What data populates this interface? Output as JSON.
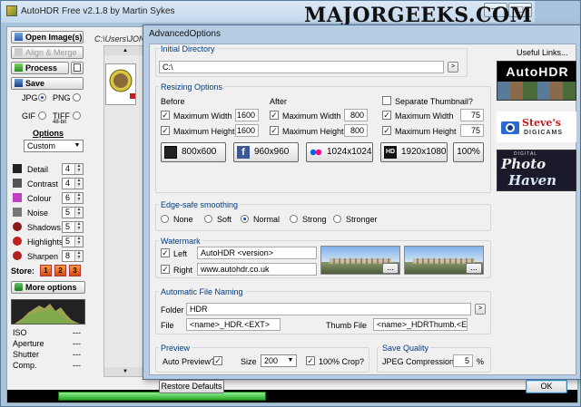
{
  "main_window": {
    "title": "AutoHDR Free v2.1.8 by Martin Sykes",
    "minimize_glyph": "—",
    "maximize_glyph": "☐"
  },
  "watermark": "MAJORGEEKS.COM",
  "left_panel": {
    "open_images": "Open Image(s)",
    "align_merge": "Align & Merge",
    "process": "Process",
    "save": "Save",
    "path": "C:\\Users\\JON-MA",
    "format_jpg": "JPG",
    "format_png": "PNG",
    "format_gif": "GIF",
    "format_tiff": "TIFF",
    "tiff_bits": "48-bit",
    "options_label": "Options",
    "preset": "Custom",
    "sliders": [
      {
        "label": "Detail",
        "value": "4"
      },
      {
        "label": "Contrast",
        "value": "4"
      },
      {
        "label": "Colour",
        "value": "6"
      },
      {
        "label": "Noise",
        "value": "5"
      },
      {
        "label": "Shadows",
        "value": "5"
      },
      {
        "label": "Highlights",
        "value": "5"
      },
      {
        "label": "Sharpen",
        "value": "8"
      }
    ],
    "store_label": "Store:",
    "store_buttons": [
      "1",
      "2",
      "3"
    ],
    "more_options": "More options",
    "exif": [
      {
        "label": "ISO",
        "value": "---"
      },
      {
        "label": "Aperture",
        "value": "---"
      },
      {
        "label": "Shutter",
        "value": "---"
      },
      {
        "label": "Comp.",
        "value": "---"
      }
    ],
    "progress_fraction": 0.37
  },
  "dialog": {
    "title": "AdvancedOptions",
    "initial_directory": {
      "label": "Initial Directory",
      "value": "C:\\",
      "browse": ">"
    },
    "useful_links": "Useful Links...",
    "resizing": {
      "label": "Resizing Options",
      "before": {
        "label": "Before",
        "max_width_label": "Maximum Width",
        "max_width": "1600",
        "max_height_label": "Maximum Height",
        "max_height": "1600"
      },
      "after": {
        "label": "After",
        "max_width_label": "Maximum Width",
        "max_width": "800",
        "max_height_label": "Maximum Height",
        "max_height": "800"
      },
      "thumb": {
        "label": "Separate Thumbnail?",
        "max_width_label": "Maximum Width",
        "max_width": "75",
        "max_height_label": "Maximum Height",
        "max_height": "75"
      },
      "presets": [
        "800x600",
        "960x960",
        "1024x1024",
        "1920x1080",
        "100%"
      ]
    },
    "smoothing": {
      "label": "Edge-safe smoothing",
      "options": [
        "None",
        "Soft",
        "Normal",
        "Strong",
        "Stronger"
      ],
      "selected": "Normal"
    },
    "watermark": {
      "label": "Watermark",
      "left_label": "Left",
      "left_value": "AutoHDR <version>",
      "right_label": "Right",
      "right_value": "www.autohdr.co.uk",
      "ellipsis": "..."
    },
    "file_naming": {
      "label": "Automatic File Naming",
      "folder_label": "Folder",
      "folder_value": "HDR",
      "file_label": "File",
      "file_value": "<name>_HDR.<EXT>",
      "thumb_label": "Thumb File",
      "thumb_value": "<name>_HDRThumb.<EXT>",
      "browse": ">"
    },
    "preview": {
      "label": "Preview",
      "auto_label": "Auto Preview?",
      "size_label": "Size",
      "size_value": "200",
      "crop_label": "100% Crop?"
    },
    "save_quality": {
      "label": "Save Quality",
      "jpeg_label": "JPEG Compression",
      "jpeg_value": "5",
      "unit": "%"
    },
    "restore_defaults": "Restore Defaults",
    "ok": "OK"
  },
  "links": [
    {
      "name": "AutoHDR",
      "text": "AutoHDR"
    },
    {
      "name": "Steve's Digicams",
      "text": "Steve's",
      "sub": "DIGICAMS"
    },
    {
      "name": "Photo Haven",
      "top": "DIGITAL",
      "text": "Photo",
      "text2": "Haven"
    }
  ]
}
